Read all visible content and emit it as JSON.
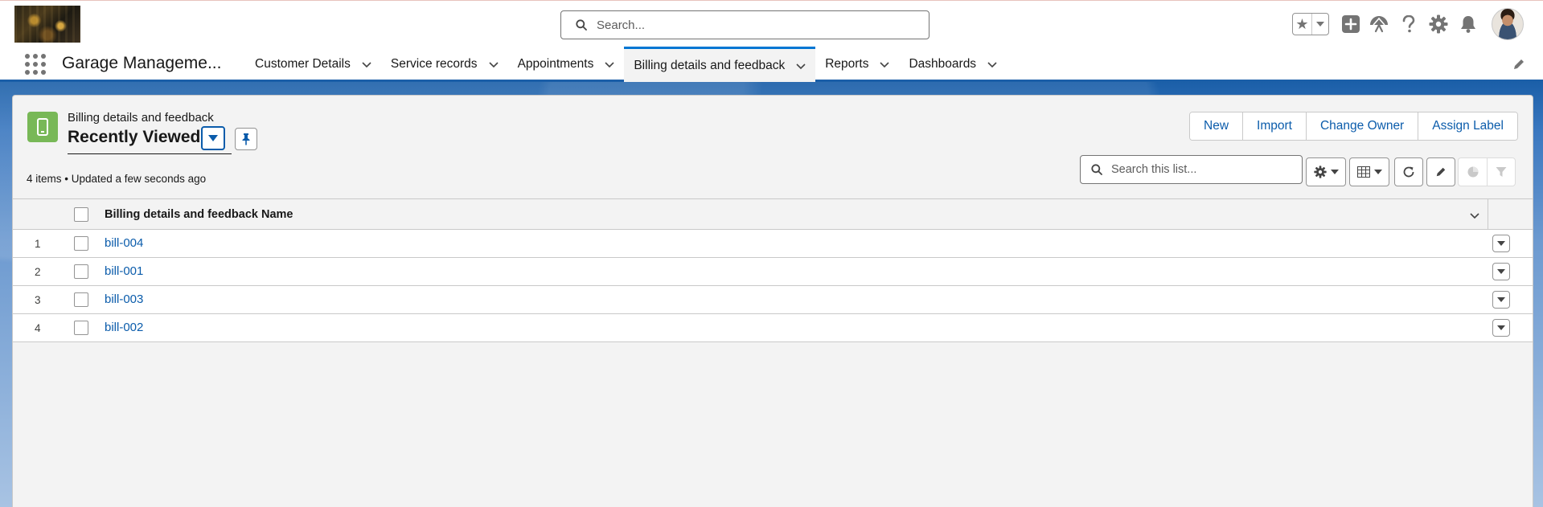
{
  "global_header": {
    "search_placeholder": "Search...",
    "icons": [
      "favorites-star-icon",
      "chevron-down-icon",
      "add-icon",
      "trailhead-icon",
      "help-icon",
      "setup-gear-icon",
      "notifications-bell-icon",
      "user-avatar"
    ]
  },
  "nav": {
    "app_name": "Garage Manageme...",
    "tabs": [
      {
        "label": "Customer Details",
        "active": false
      },
      {
        "label": "Service records",
        "active": false
      },
      {
        "label": "Appointments",
        "active": false
      },
      {
        "label": "Billing details and feedback",
        "active": true
      },
      {
        "label": "Reports",
        "active": false
      },
      {
        "label": "Dashboards",
        "active": false
      }
    ]
  },
  "list_view": {
    "object_label": "Billing details and feedback",
    "title": "Recently Viewed",
    "meta": "4 items • Updated a few seconds ago",
    "actions": [
      "New",
      "Import",
      "Change Owner",
      "Assign Label"
    ],
    "search_placeholder": "Search this list...",
    "column_header": "Billing details and feedback Name",
    "rows": [
      {
        "num": "1",
        "name": "bill-004"
      },
      {
        "num": "2",
        "name": "bill-001"
      },
      {
        "num": "3",
        "name": "bill-003"
      },
      {
        "num": "4",
        "name": "bill-002"
      }
    ]
  },
  "colors": {
    "brand_blue": "#1b5fa8",
    "link_blue": "#0b5cab",
    "object_icon_green": "#78b857",
    "card_background": "#f3f3f3"
  }
}
